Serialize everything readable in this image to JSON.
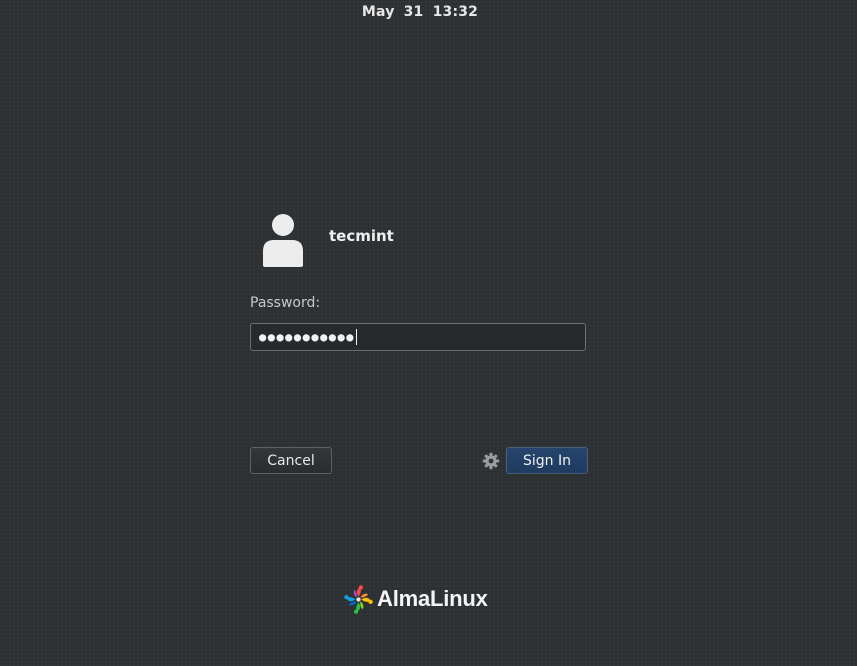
{
  "top_bar": {
    "date": "May 31",
    "time": "13:32"
  },
  "login": {
    "avatar_icon": "user-avatar-icon",
    "username": "tecmint",
    "password_label": "Password:",
    "password_masked": "●●●●●●●●●●●",
    "cancel_label": "Cancel",
    "sign_in_label": "Sign In",
    "settings_icon": "gear-icon"
  },
  "branding": {
    "logo_icon": "almalinux-logo-icon",
    "name": "AlmaLinux"
  },
  "colors": {
    "background": "#2f3336",
    "sign_in_button": "#23416a",
    "field_background": "#262a2d",
    "text": "#eeeeec"
  }
}
